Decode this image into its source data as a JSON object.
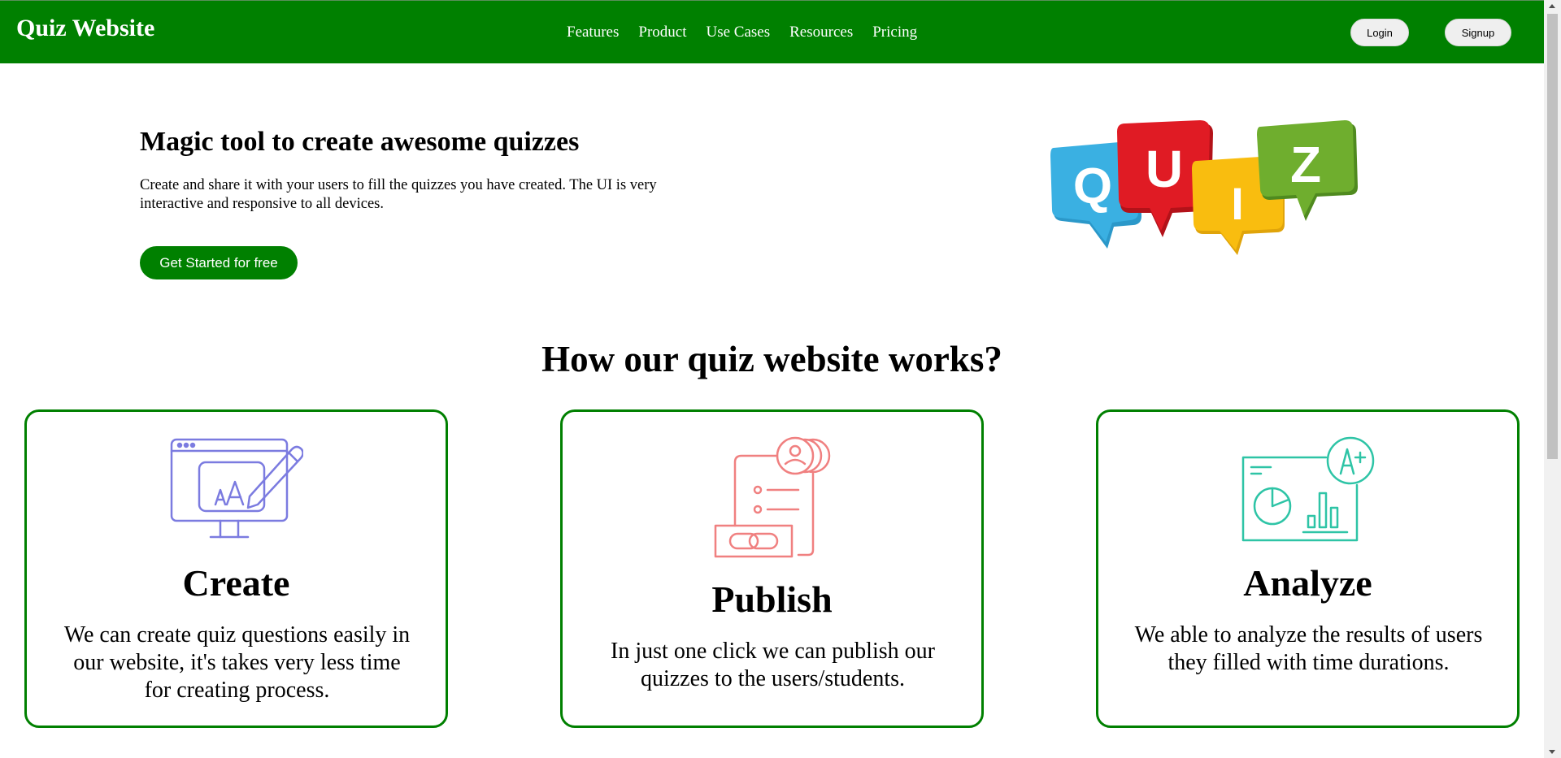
{
  "header": {
    "brand": "Quiz Website",
    "nav": [
      "Features",
      "Product",
      "Use Cases",
      "Resources",
      "Pricing"
    ],
    "login_label": "Login",
    "signup_label": "Signup"
  },
  "hero": {
    "title": "Magic tool to create awesome quizzes",
    "text": "Create and share it with your users to fill the quizzes you have created. The UI is very interactive and responsive to all devices.",
    "cta_label": "Get Started for free",
    "logo": {
      "letters": [
        "Q",
        "U",
        "I",
        "Z"
      ],
      "colors": [
        "#3ab0e2",
        "#e01b24",
        "#f9bd0f",
        "#6fae2e"
      ]
    }
  },
  "how_it_works": {
    "title": "How our quiz website works?",
    "cards": [
      {
        "icon": "monitor-pencil-icon",
        "title": "Create",
        "text": "We can create quiz questions easily in our website, it's takes very less time for creating process.",
        "color": "#7b7be0"
      },
      {
        "icon": "document-link-icon",
        "title": "Publish",
        "text": "In just one click we can publish our quizzes to the users/students.",
        "color": "#f08080"
      },
      {
        "icon": "chart-grade-icon",
        "title": "Analyze",
        "text": "We able to analyze the results of users they filled with time durations.",
        "color": "#2ec4a6"
      }
    ]
  },
  "theme": {
    "primary": "#008000"
  }
}
